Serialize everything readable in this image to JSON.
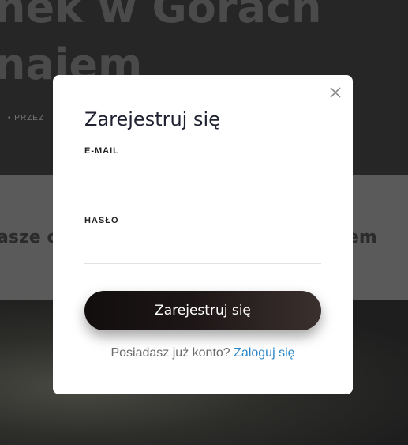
{
  "background": {
    "title_line1": "nek w Górach",
    "title_line2": "najem",
    "byline": "• PRZEZ",
    "band_left": "asze o",
    "band_right": "em"
  },
  "modal": {
    "title": "Zarejestruj się",
    "email_label": "E-MAIL",
    "email_value": "",
    "password_label": "HASŁO",
    "password_value": "",
    "submit_label": "Zarejestruj się",
    "login_prompt": "Posiadasz już konto?",
    "login_link": "Zaloguj się"
  },
  "colors": {
    "link": "#2a86c8",
    "button": "#1d1616",
    "title": "#1f2230"
  },
  "icons": {
    "close": "close-icon"
  }
}
